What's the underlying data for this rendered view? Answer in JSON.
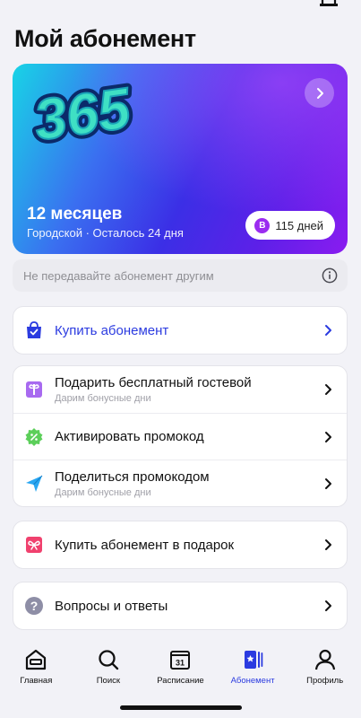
{
  "header": {
    "title": "Мой абонемент"
  },
  "subscription": {
    "logo_text": "365",
    "period": "12 месяцев",
    "details": "Городской · Осталось 24 дня",
    "badge_letter": "B",
    "days_label": "115 дней"
  },
  "notice": {
    "text": "Не передавайте абонемент другим"
  },
  "buy": {
    "label": "Купить абонемент"
  },
  "promo_group": [
    {
      "label": "Подарить бесплатный гостевой",
      "sub": "Дарим бонусные дни"
    },
    {
      "label": "Активировать промокод",
      "sub": ""
    },
    {
      "label": "Поделиться промокодом",
      "sub": "Дарим бонусные дни"
    }
  ],
  "gift": {
    "label": "Купить абонемент в подарок"
  },
  "faq": {
    "label": "Вопросы и ответы"
  },
  "tabs": [
    {
      "label": "Главная",
      "icon": "home-icon"
    },
    {
      "label": "Поиск",
      "icon": "search-icon"
    },
    {
      "label": "Расписание",
      "icon": "calendar-icon",
      "icon_text": "31"
    },
    {
      "label": "Абонемент",
      "icon": "pass-icon",
      "active": true
    },
    {
      "label": "Профиль",
      "icon": "profile-icon"
    }
  ],
  "colors": {
    "accent": "#2b3be0",
    "badge": "#9b2cf0",
    "green": "#5ccf5a",
    "purple": "#a86af0",
    "pink": "#f0416e"
  }
}
